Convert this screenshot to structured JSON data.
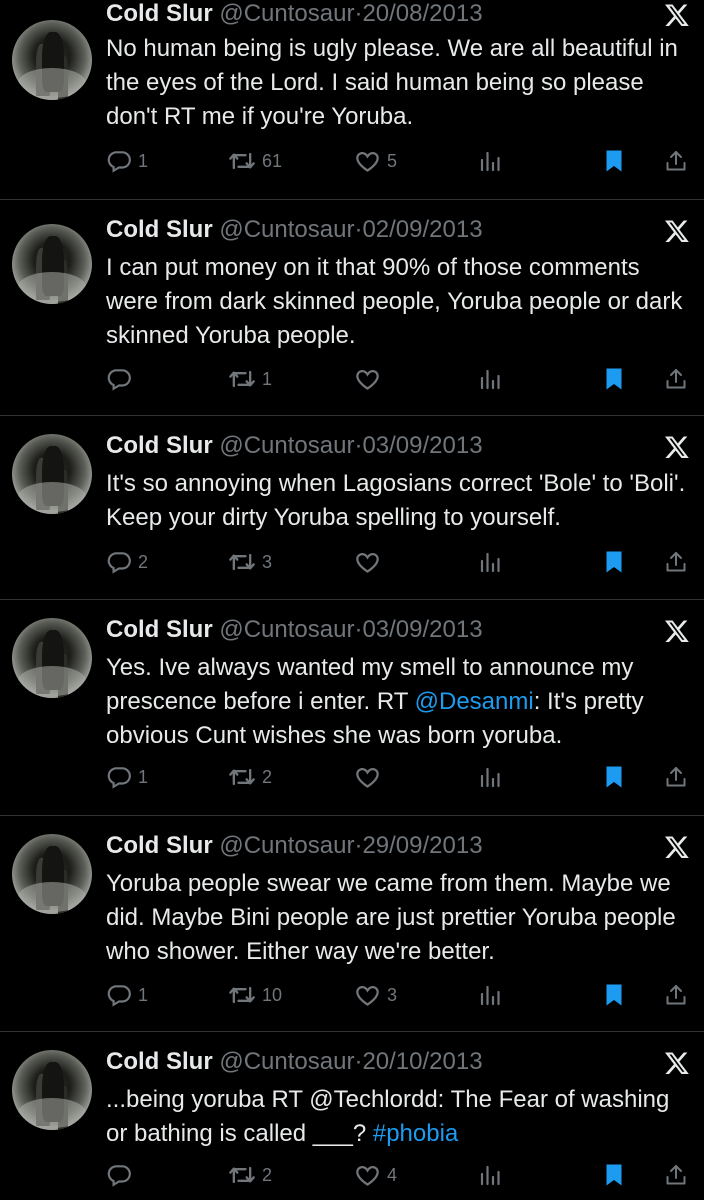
{
  "colors": {
    "background": "#000000",
    "text": "#e7e9ea",
    "muted": "#71767b",
    "link": "#1d9bf0",
    "bookmark": "#1d9bf0",
    "divider": "#2f3336"
  },
  "icons": [
    "reply-icon",
    "retweet-icon",
    "like-icon",
    "views-icon",
    "bookmark-icon",
    "share-icon",
    "x-logo-icon"
  ],
  "tweets": [
    {
      "name": "Cold Slur",
      "handle": "@Cuntosaur",
      "sep": "·",
      "date": "20/08/2013",
      "text": "No human being is ugly please. We are all beautiful in the eyes of the Lord. I said human being so please don't RT me if you're Yoruba.",
      "replies": "1",
      "retweets": "61",
      "likes": "5"
    },
    {
      "name": "Cold Slur",
      "handle": "@Cuntosaur",
      "sep": "·",
      "date": "02/09/2013",
      "text": "I can put money on it that 90% of those comments were from dark skinned people, Yoruba people or dark skinned Yoruba people.",
      "replies": "",
      "retweets": "1",
      "likes": ""
    },
    {
      "name": "Cold Slur",
      "handle": "@Cuntosaur",
      "sep": "·",
      "date": "03/09/2013",
      "text": "It's so annoying when Lagosians correct 'Bole' to 'Boli'. Keep your dirty Yoruba spelling to yourself.",
      "replies": "2",
      "retweets": "3",
      "likes": ""
    },
    {
      "name": "Cold Slur",
      "handle": "@Cuntosaur",
      "sep": "·",
      "date": "03/09/2013",
      "text_pre": "Yes. Ive always wanted my smell to announce my prescence before i enter. RT ",
      "mention": "@Desanmi",
      "text_post": ": It's pretty obvious Cunt wishes she was born yoruba.",
      "replies": "1",
      "retweets": "2",
      "likes": ""
    },
    {
      "name": "Cold Slur",
      "handle": "@Cuntosaur",
      "sep": "·",
      "date": "29/09/2013",
      "text": "Yoruba people swear we came from them. Maybe we did. Maybe Bini people are just prettier Yoruba people who shower. Either way we're better.",
      "replies": "1",
      "retweets": "10",
      "likes": "3"
    },
    {
      "name": "Cold Slur",
      "handle": "@Cuntosaur",
      "sep": "·",
      "date": "20/10/2013",
      "text_pre": "...being yoruba RT @Techlordd: The Fear of washing or bathing is called ___? ",
      "hashtag": "#phobia",
      "replies": "",
      "retweets": "2",
      "likes": "4"
    }
  ]
}
